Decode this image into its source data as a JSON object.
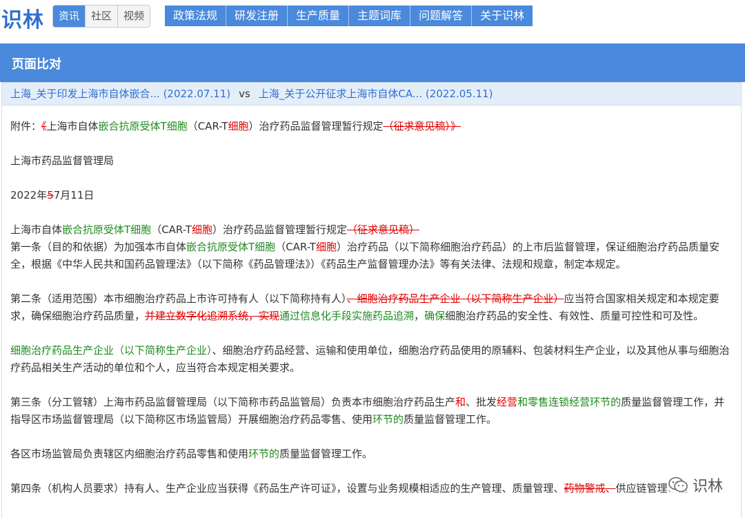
{
  "brand": {
    "logo": "识林"
  },
  "segments": [
    {
      "label": "资讯",
      "active": true
    },
    {
      "label": "社区",
      "active": false
    },
    {
      "label": "视频",
      "active": false
    }
  ],
  "nav": [
    "政策法规",
    "研发注册",
    "生产质量",
    "主题词库",
    "问题解答",
    "关于识林"
  ],
  "panel": {
    "title": "页面比对"
  },
  "compare": {
    "left": "上海_关于印发上海市自体嵌合... (2022.07.11)",
    "vs": "vs",
    "right": "上海_关于公开征求上海市自体CA... (2022.05.11)"
  },
  "doc": {
    "p1": {
      "a": "附件：",
      "b": "《",
      "c": "上海市自体",
      "d": "嵌合抗原受体T细胞",
      "e": "（CAR-T",
      "f": "细胞",
      "g": "）治疗药品监督管理暂行规定",
      "h": "（征求意见稿）》"
    },
    "p2": "上海市药品监督管理局",
    "p3": {
      "a": "2022年",
      "b": "5",
      "c": "7月11日"
    },
    "p4": {
      "a": "上海市自体",
      "b": "嵌合抗原受体T细胞",
      "c": "（CAR-T",
      "d": "细胞",
      "e": "）治疗药品监督管理暂行规定",
      "f": "（征求意见稿）"
    },
    "p5": {
      "a": " 第一条（目的和依据）为加强本市自体",
      "b": "嵌合抗原受体T细胞",
      "c": "（CAR-T",
      "d": "细胞",
      "e": "）治疗药品（以下简称细胞治疗药品）的上市后监督管理，保证细胞治疗药品质量安全，根据《中华人民共和国药品管理法》（以下简称《药品管理法》）《药品生产监督管理办法》等有关法律、法规和规章，制定本规定。"
    },
    "p6": {
      "a": "第二条（适用范围）本市细胞治疗药品上市许可持有人（以下简称持有人）",
      "b": "、细胞治疗药品生产企业（以下简称生产企业）",
      "c": "应当符合国家相关规定和本规定要求，确保细胞治疗药品质量，",
      "d": "并建立数字化追溯系统，实现",
      "e": "通过信息化手段实施药品追溯",
      "f": "，",
      "g": "确保",
      "h": "细胞治疗药品的安全性、有效性、质量可控性和可及性。"
    },
    "p7": {
      "a": "细胞治疗药品生产企业（以下简称生产企业）",
      "b": "、细胞治疗药品经营、运输和使用单位，细胞治疗药品使用的原辅料、包装材料生产企业，以及其他从事与细胞治疗药品相关生产活动的单位和个人，应当符合本规定相关要求。"
    },
    "p8": {
      "a": "第三条（分工管辖）上海市药品监督管理局（以下简称市药品监管局）负责本市细胞治疗药品生产",
      "b": "和",
      "c": "、批发",
      "d": "经营",
      "e": "和零售连锁经营环节的",
      "f": "质量监督管理工作，并指导区市场监督管理局（以下简称区市场监管局）开展细胞治疗药品零售、使用",
      "g": "环节的",
      "h": "质量监督管理工作。"
    },
    "p9": {
      "a": "各区市场监管局负责辖区内细胞治疗药品零售和使用",
      "b": "环节的",
      "c": "质量监督管理工作。"
    },
    "p10": {
      "a": "第四条（机构人员要求）持有人、生产企业应当获得《药品生产许可证》，设置与业务规模相适应的生产管理、质量管理、",
      "b": "药物警戒、",
      "c": "供应链管理、信"
    }
  },
  "watermark": {
    "text": "识林"
  },
  "colors": {
    "accent": "#4a89dc",
    "added": "#1e8a1e",
    "deleted": "#e00000"
  }
}
